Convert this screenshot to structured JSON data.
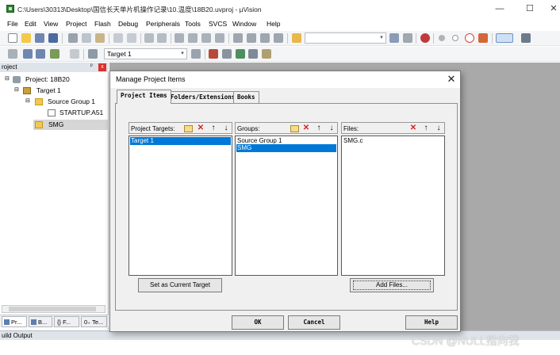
{
  "window": {
    "title": "C:\\Users\\30313\\Desktop\\国信长天单片机操作记录\\10.温度\\18B20.uvproj - µVision",
    "minimize": "—",
    "maximize": "☐",
    "close": "✕"
  },
  "menu": [
    "File",
    "Edit",
    "View",
    "Project",
    "Flash",
    "Debug",
    "Peripherals",
    "Tools",
    "SVCS",
    "Window",
    "Help"
  ],
  "toolbar": {
    "target_select": "Target 1"
  },
  "project_panel": {
    "title": "roject",
    "pin": "ᵖ",
    "close": "x",
    "tree": [
      {
        "label": "Project: 18B20",
        "icon": "project-icon"
      },
      {
        "label": "Target 1",
        "icon": "target-icon"
      },
      {
        "label": "Source Group 1",
        "icon": "folder-icon"
      },
      {
        "label": "STARTUP.A51",
        "icon": "file-icon"
      },
      {
        "label": "SMG",
        "icon": "folder-icon"
      }
    ],
    "tabs": [
      "Pr...",
      "B...",
      "{} F...",
      "0₊ Te..."
    ]
  },
  "build_output": {
    "title": "uild Output"
  },
  "dialog": {
    "title": "Manage Project Items",
    "close": "✕",
    "tabs": [
      "Project Items",
      "Folders/Extensions",
      "Books"
    ],
    "targets": {
      "label": "Project Targets:",
      "items": [
        "Target 1"
      ],
      "selected_index": 0
    },
    "groups": {
      "label": "Groups:",
      "items": [
        "Source Group 1",
        "SMG"
      ],
      "selected_index": 1
    },
    "files": {
      "label": "Files:",
      "items": [
        "SMG.c"
      ]
    },
    "icons": {
      "new": "new-folder-icon",
      "delete": "delete-icon",
      "up": "↑",
      "down": "↓",
      "delete_glyph": "✕"
    },
    "buttons": {
      "set_current": "Set as Current Target",
      "add_files": "Add Files...",
      "ok": "OK",
      "cancel": "Cancel",
      "help": "Help"
    }
  },
  "watermark": "CSDN @NULL指向我"
}
